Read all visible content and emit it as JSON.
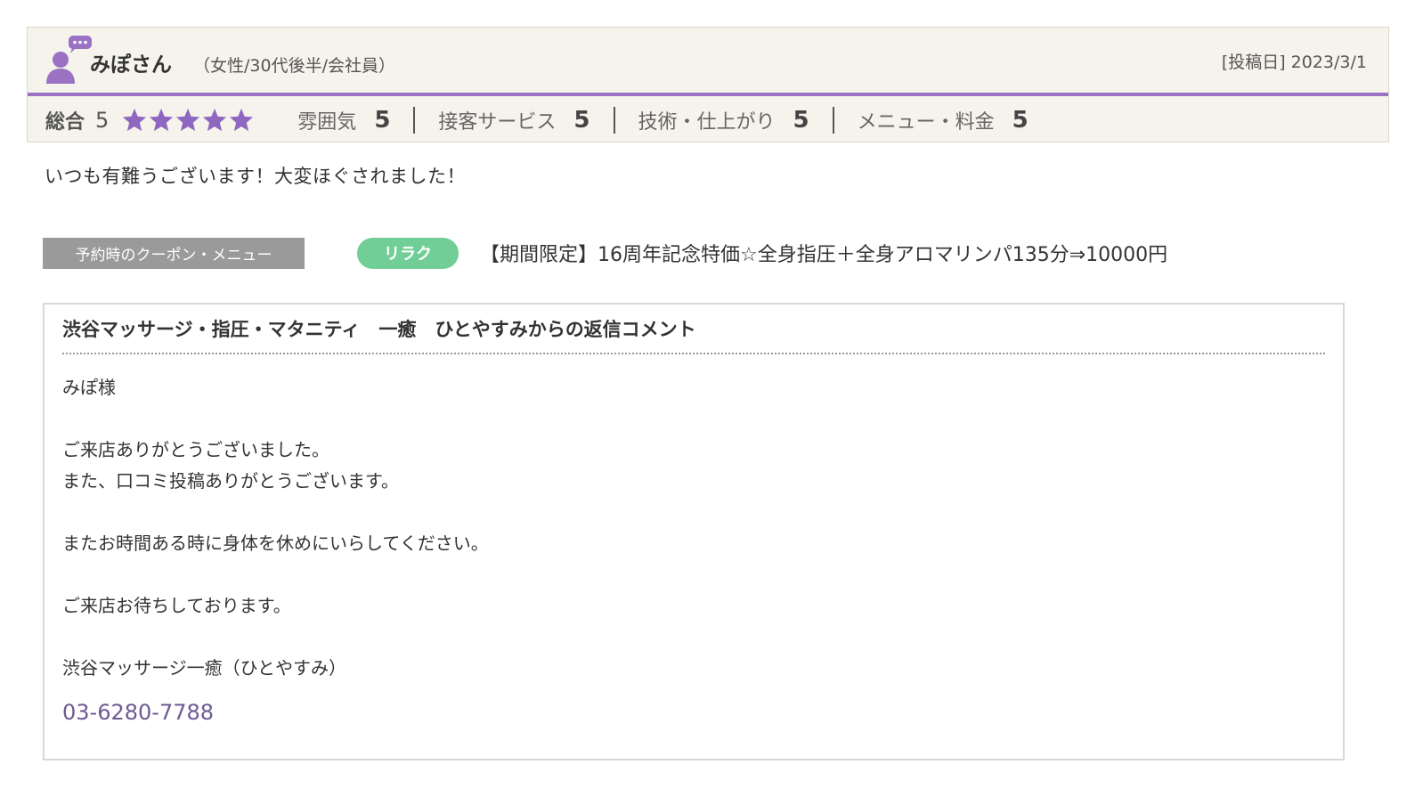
{
  "review": {
    "reviewer_name": "みぽさん",
    "reviewer_meta": "（女性/30代後半/会社員）",
    "post_date_label": "[投稿日]",
    "post_date": "2023/3/1",
    "overall_label": "総合",
    "overall_score": "5",
    "stars": 5,
    "ratings": [
      {
        "label": "雰囲気",
        "value": "5"
      },
      {
        "label": "接客サービス",
        "value": "5"
      },
      {
        "label": "技術・仕上がり",
        "value": "5"
      },
      {
        "label": "メニュー・料金",
        "value": "5"
      }
    ],
    "body": "いつも有難うございます！大変ほぐされました！"
  },
  "coupon": {
    "label": "予約時のクーポン・メニュー",
    "tag": "リラク",
    "text": "【期間限定】16周年記念特価☆全身指圧＋全身アロマリンパ135分⇒10000円"
  },
  "reply": {
    "title": "渋谷マッサージ・指圧・マタニティ　一癒　ひとやすみからの返信コメント",
    "lines": [
      "みぽ様",
      "",
      "ご来店ありがとうございました。",
      "また、口コミ投稿ありがとうございます。",
      "",
      "またお時間ある時に身体を休めにいらしてください。",
      "",
      "ご来店お待ちしております。",
      "",
      "渋谷マッサージ一癒（ひとやすみ）"
    ],
    "phone": "03-6280-7788"
  },
  "colors": {
    "accent_purple": "#9b72c3",
    "star_purple": "#8e67c0",
    "tag_green": "#71ce96",
    "phone_color": "#6d5a92"
  }
}
